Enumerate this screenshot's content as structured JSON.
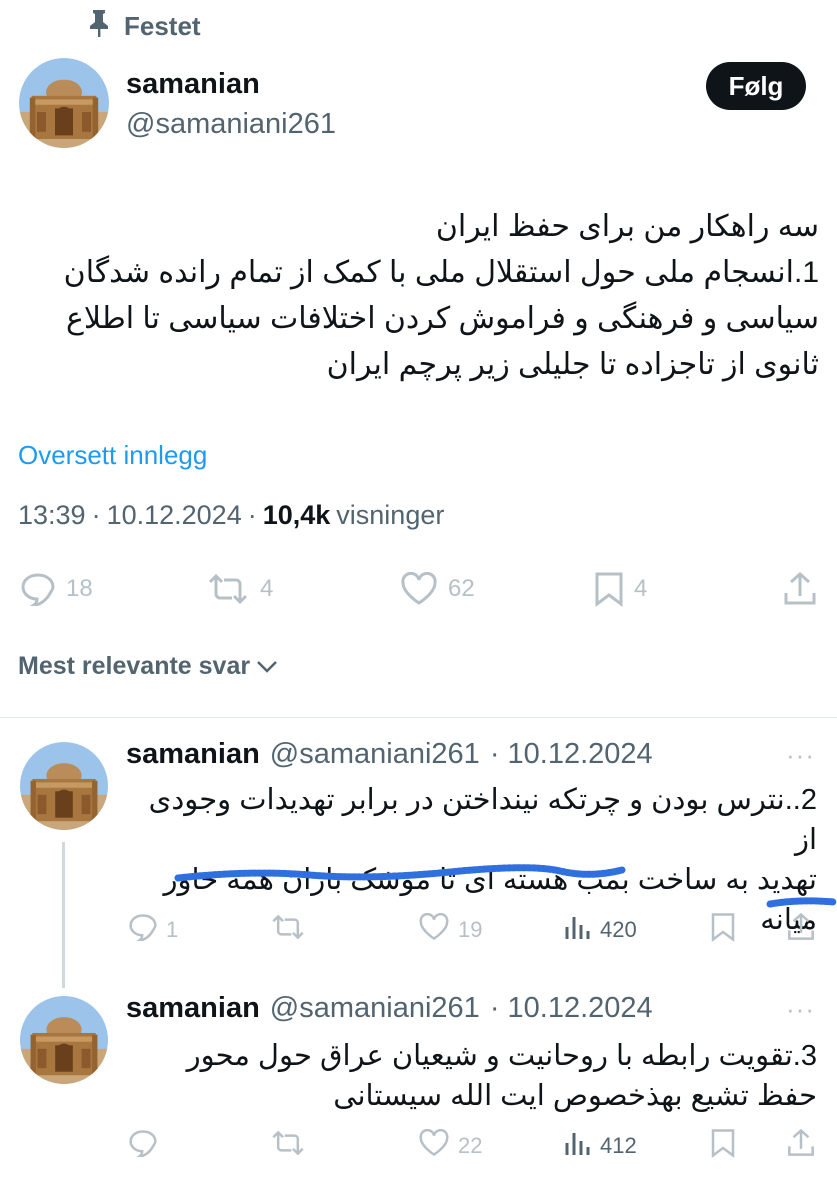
{
  "pinned_label": "Festet",
  "main_tweet": {
    "author_name": "samanian",
    "author_handle": "@samaniani261",
    "follow_label": "Følg",
    "text_lines": [
      "سه راهکار من برای حفظ ایران",
      "1.انسجام ملی حول استقلال ملی با کمک از تمام رانده شدگان",
      "سیاسی و فرهنگی و فراموش کردن اختلافات سیاسی تا اطلاع",
      "ثانوی از تاجزاده تا جلیلی زیر پرچم ایران"
    ],
    "translate_label": "Oversett innlegg",
    "time": "13:39",
    "date": "10.12.2024",
    "views_count": "10,4k",
    "views_label": "visninger",
    "sep": "·",
    "replies": "18",
    "reposts": "4",
    "likes": "62",
    "bookmarks": "4"
  },
  "sort_label": "Mest relevante svar",
  "replies": [
    {
      "author_name": "samanian",
      "author_handle": "@samaniani261",
      "date": "· 10.12.2024",
      "more": "···",
      "text_lines": [
        "2..نترس بودن و چرتکه نینداختن در برابر تهدیدات وجودی از",
        "تهدید به ساخت بمب هسته ای تا موشک باران همه خاور",
        "میانه"
      ],
      "replies": "1",
      "reposts": "",
      "likes": "19",
      "views": "420"
    },
    {
      "author_name": "samanian",
      "author_handle": "@samaniani261",
      "date": "· 10.12.2024",
      "more": "···",
      "text_lines": [
        "3.تقویت رابطه با روحانیت و  شیعیان  عراق حول محور",
        "حفظ تشیع بهذخصوص ایت الله سیستانی"
      ],
      "replies": "",
      "reposts": "",
      "likes": "22",
      "views": "412"
    }
  ],
  "icons": {
    "pin": "pin-icon",
    "reply": "reply-icon",
    "repost": "repost-icon",
    "like": "heart-icon",
    "bookmark": "bookmark-icon",
    "share": "share-icon",
    "views": "views-icon",
    "chevron": "chevron-down-icon",
    "more": "more-icon"
  },
  "colors": {
    "accent": "#1d9bf0",
    "text": "#0f1419",
    "muted": "#536471",
    "follow_bg": "#0f1419",
    "highlight_scribble": "#2f6fe0"
  }
}
